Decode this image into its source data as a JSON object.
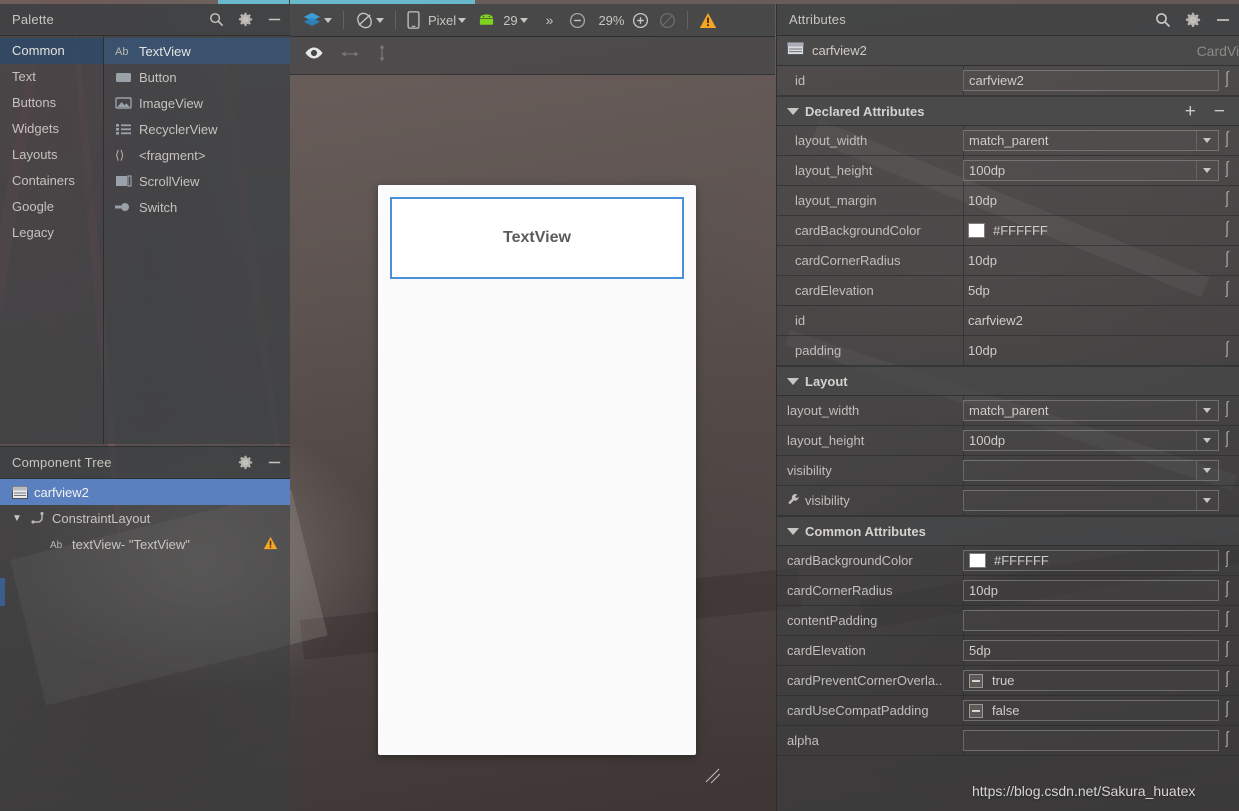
{
  "palette": {
    "title": "Palette",
    "icons": [
      "search-icon",
      "gear-icon",
      "minimize-icon"
    ],
    "categories": [
      {
        "label": "Common",
        "selected": true
      },
      {
        "label": "Text",
        "selected": false
      },
      {
        "label": "Buttons",
        "selected": false
      },
      {
        "label": "Widgets",
        "selected": false
      },
      {
        "label": "Layouts",
        "selected": false
      },
      {
        "label": "Containers",
        "selected": false
      },
      {
        "label": "Google",
        "selected": false
      },
      {
        "label": "Legacy",
        "selected": false
      }
    ],
    "items": [
      {
        "label": "TextView",
        "icon": "ab-text-icon",
        "selected": true
      },
      {
        "label": "Button",
        "icon": "button-icon",
        "selected": false
      },
      {
        "label": "ImageView",
        "icon": "image-icon",
        "selected": false
      },
      {
        "label": "RecyclerView",
        "icon": "list-icon",
        "selected": false
      },
      {
        "label": "<fragment>",
        "icon": "code-brackets-icon",
        "selected": false
      },
      {
        "label": "ScrollView",
        "icon": "scrollview-icon",
        "selected": false
      },
      {
        "label": "Switch",
        "icon": "switch-icon",
        "selected": false
      }
    ]
  },
  "component_tree": {
    "title": "Component Tree",
    "icons": [
      "gear-icon",
      "minimize-icon"
    ],
    "nodes": [
      {
        "label": "carfview2",
        "icon": "cardview-icon",
        "indent": 0,
        "selected": true,
        "expander": "",
        "warning": false
      },
      {
        "label": "ConstraintLayout",
        "icon": "constraint-icon",
        "indent": 1,
        "selected": false,
        "expander": "▼",
        "warning": false
      },
      {
        "label": "textView- \"TextView\"",
        "icon": "ab-text-icon",
        "indent": 2,
        "selected": false,
        "expander": "",
        "warning": true
      }
    ]
  },
  "design_toolbar": {
    "design_mode_label": "",
    "orientation_label": "",
    "device_label": "Pixel",
    "api_label": "29",
    "overflow_label": "»",
    "zoom_label": "29%",
    "zoom_out_icon": "zoom-out-icon",
    "zoom_in_icon": "zoom-in-icon",
    "zoom_fit_icon": "zoom-fit-icon",
    "warning_icon": "warning-icon"
  },
  "design_subbar": {
    "eye_icon": "eye-icon",
    "horizontal_icon": "horizontal-arrows-icon",
    "vertical_icon": "vertical-arrows-icon"
  },
  "canvas": {
    "cardview_text": "TextView"
  },
  "attributes": {
    "title": "Attributes",
    "icons": [
      "search-icon",
      "gear-icon",
      "minimize-icon"
    ],
    "selected_component": "carfview2",
    "selected_type": "CardView",
    "id_row": {
      "label": "id",
      "value": "carfview2"
    },
    "sections": [
      {
        "title": "Declared Attributes",
        "has_add_remove": true,
        "add_label": "+",
        "remove_label": "−",
        "rows": [
          {
            "label": "layout_width",
            "value": "match_parent",
            "type": "dropdown",
            "boxed": true,
            "paren": true
          },
          {
            "label": "layout_height",
            "value": "100dp",
            "type": "dropdown",
            "boxed": true,
            "paren": true
          },
          {
            "label": "layout_margin",
            "value": "10dp",
            "type": "text",
            "boxed": false,
            "paren": true
          },
          {
            "label": "cardBackgroundColor",
            "value": "#FFFFFF",
            "type": "color",
            "boxed": false,
            "paren": true,
            "swatch": "#FFFFFF"
          },
          {
            "label": "cardCornerRadius",
            "value": "10dp",
            "type": "text",
            "boxed": false,
            "paren": true
          },
          {
            "label": "cardElevation",
            "value": "5dp",
            "type": "text",
            "boxed": false,
            "paren": true
          },
          {
            "label": "id",
            "value": "carfview2",
            "type": "text",
            "boxed": false,
            "paren": false
          },
          {
            "label": "padding",
            "value": "10dp",
            "type": "text",
            "boxed": false,
            "paren": true
          }
        ]
      },
      {
        "title": "Layout",
        "has_add_remove": false,
        "rows": [
          {
            "label": "layout_width",
            "value": "match_parent",
            "type": "dropdown",
            "boxed": true,
            "paren": true
          },
          {
            "label": "layout_height",
            "value": "100dp",
            "type": "dropdown",
            "boxed": true,
            "paren": true
          },
          {
            "label": "visibility",
            "value": "",
            "type": "dropdown",
            "boxed": true,
            "paren": false
          },
          {
            "label": "visibility",
            "value": "",
            "type": "dropdown",
            "boxed": true,
            "paren": false,
            "wrench": true
          }
        ]
      },
      {
        "title": "Common Attributes",
        "has_add_remove": false,
        "rows": [
          {
            "label": "cardBackgroundColor",
            "value": "#FFFFFF",
            "type": "color",
            "boxed": true,
            "paren": true,
            "swatch": "#FFFFFF"
          },
          {
            "label": "cardCornerRadius",
            "value": "10dp",
            "type": "text",
            "boxed": true,
            "paren": true
          },
          {
            "label": "contentPadding",
            "value": "",
            "type": "text",
            "boxed": true,
            "paren": true
          },
          {
            "label": "cardElevation",
            "value": "5dp",
            "type": "text",
            "boxed": true,
            "paren": true
          },
          {
            "label": "cardPreventCornerOverla..",
            "value": "true",
            "type": "checkbox",
            "boxed": true,
            "paren": true
          },
          {
            "label": "cardUseCompatPadding",
            "value": "false",
            "type": "checkbox",
            "boxed": true,
            "paren": true
          },
          {
            "label": "alpha",
            "value": "",
            "type": "text",
            "boxed": true,
            "paren": true
          }
        ]
      }
    ]
  },
  "watermark": "https://blog.csdn.net/Sakura_huatex",
  "colors": {
    "accent_blue": "#6ab8cc",
    "selection_blue": "#5b80c0",
    "cardview_border": "#4a90d9",
    "warning_orange": "#f5a623",
    "android_green": "#7ed321"
  }
}
